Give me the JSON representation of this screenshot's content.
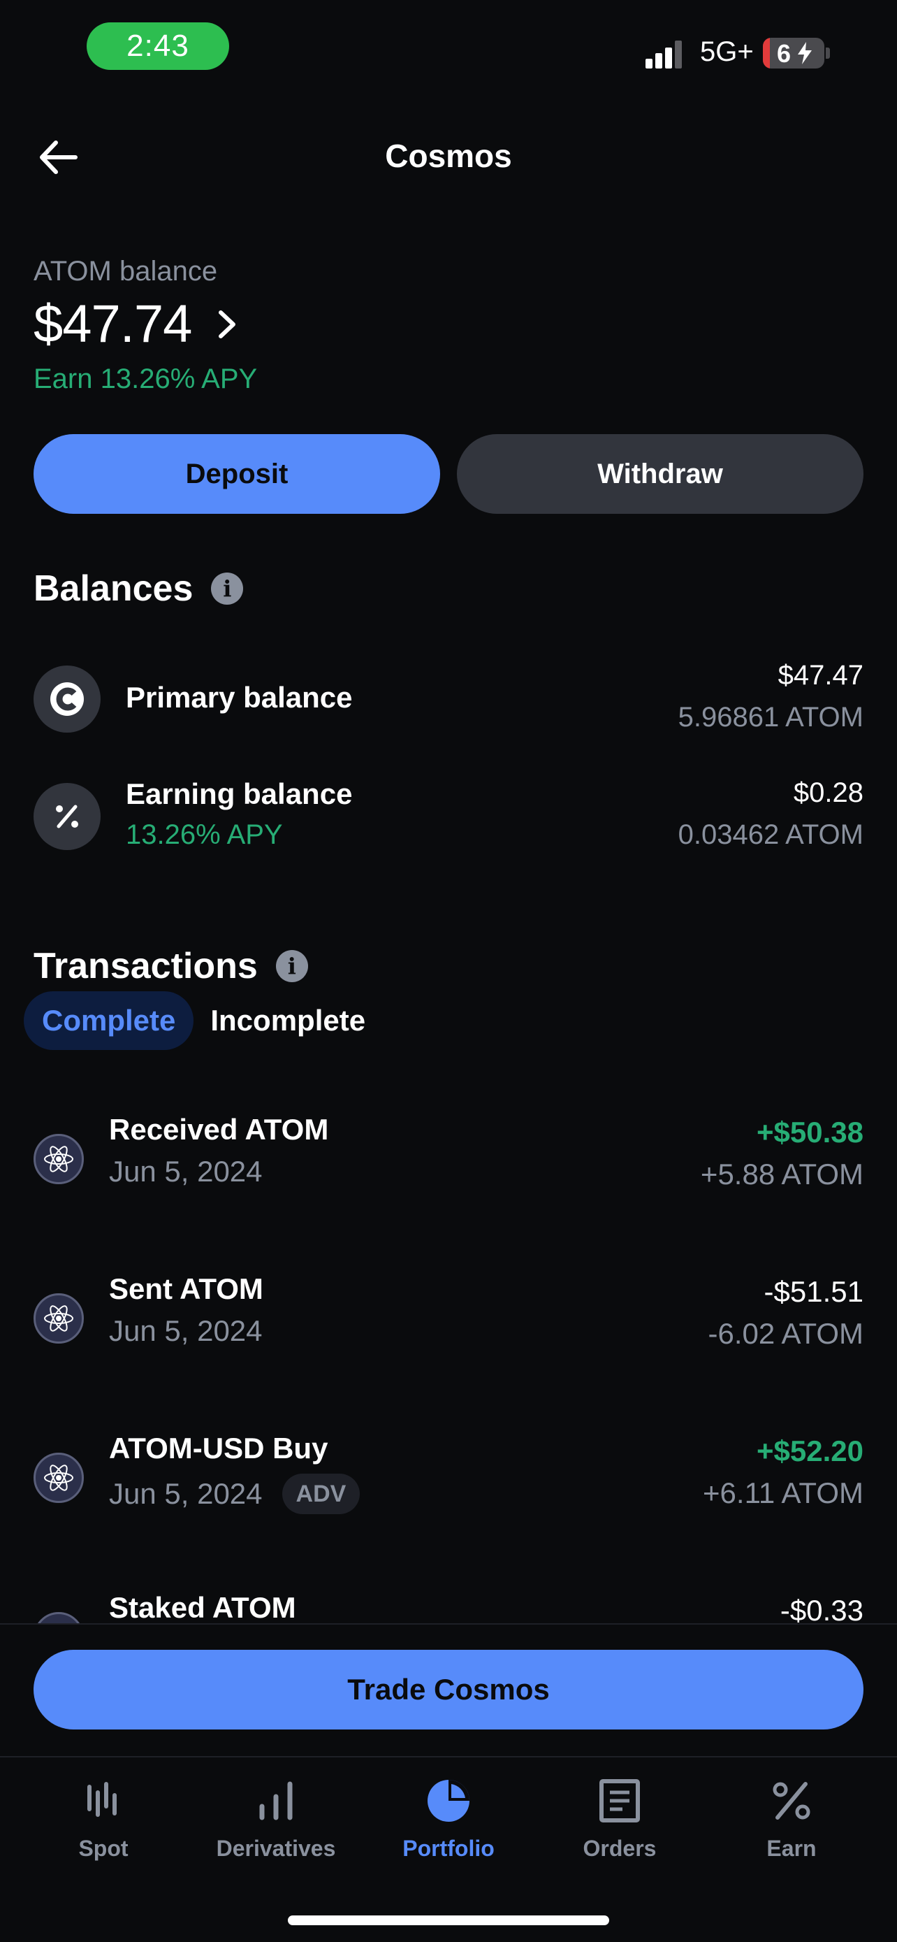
{
  "status_bar": {
    "time": "2:43",
    "network": "5G+",
    "battery": "6"
  },
  "header": {
    "title": "Cosmos"
  },
  "balance": {
    "label": "ATOM balance",
    "value": "$47.74",
    "apy": "Earn 13.26% APY"
  },
  "actions": {
    "deposit": "Deposit",
    "withdraw": "Withdraw"
  },
  "balances_section": {
    "title": "Balances",
    "items": [
      {
        "name": "Primary balance",
        "sub": "",
        "usd": "$47.47",
        "atom": "5.96861 ATOM",
        "icon": "coinbase-icon"
      },
      {
        "name": "Earning balance",
        "sub": "13.26% APY",
        "usd": "$0.28",
        "atom": "0.03462 ATOM",
        "icon": "percent-icon"
      }
    ]
  },
  "transactions": {
    "title": "Transactions",
    "tabs": [
      {
        "label": "Complete",
        "active": true
      },
      {
        "label": "Incomplete",
        "active": false
      }
    ],
    "items": [
      {
        "name": "Received ATOM",
        "date": "Jun 5, 2024",
        "badge": "",
        "amount": "+$50.38",
        "qty": "+5.88 ATOM",
        "positive": true
      },
      {
        "name": "Sent ATOM",
        "date": "Jun 5, 2024",
        "badge": "",
        "amount": "-$51.51",
        "qty": "-6.02 ATOM",
        "positive": false
      },
      {
        "name": "ATOM-USD Buy",
        "date": "Jun 5, 2024",
        "badge": "ADV",
        "amount": "+$52.20",
        "qty": "+6.11 ATOM",
        "positive": true
      },
      {
        "name": "Staked ATOM",
        "date": "",
        "badge": "",
        "amount": "-$0.33",
        "qty": "",
        "positive": false
      }
    ]
  },
  "trade_button": "Trade Cosmos",
  "nav": [
    {
      "label": "Spot",
      "icon": "spot-icon",
      "active": false
    },
    {
      "label": "Derivatives",
      "icon": "bar-chart-icon",
      "active": false
    },
    {
      "label": "Portfolio",
      "icon": "pie-chart-icon",
      "active": true
    },
    {
      "label": "Orders",
      "icon": "document-icon",
      "active": false
    },
    {
      "label": "Earn",
      "icon": "percent-icon",
      "active": false
    }
  ],
  "colors": {
    "accent": "#578bfa",
    "positive": "#27ad75",
    "muted": "#8a919e",
    "surface": "#32353d",
    "background": "#0a0b0d"
  }
}
